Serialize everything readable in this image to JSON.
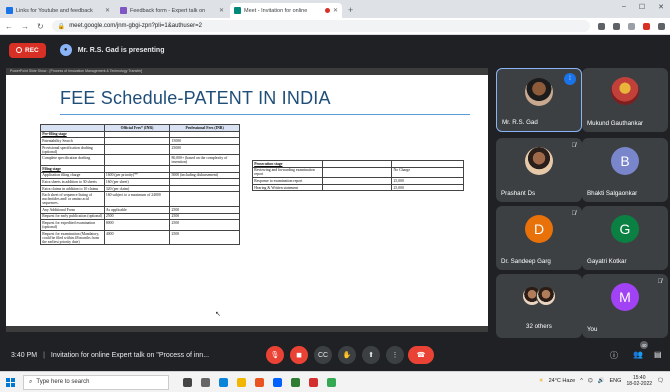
{
  "browser": {
    "tabs": [
      {
        "title": "Links for Youtube and feedback",
        "active": false,
        "color": "#1a73e8"
      },
      {
        "title": "Feedback form - Expert talk on",
        "active": false,
        "color": "#7e57c2"
      },
      {
        "title": "Meet - Invitation for online",
        "active": true,
        "color": "#00897b"
      }
    ],
    "url": "meet.google.com/jnm-gbgi-zpn?pli=1&authuser=2"
  },
  "meet": {
    "rec_label": "REC",
    "presenting_text": "Mr. R.S. Gad is presenting",
    "bottom_time": "3:40 PM",
    "meeting_title": "Invitation for online Expert talk on \"Process of inn...",
    "badge_count": "40"
  },
  "slide": {
    "window_title": "PowerPoint Slide Show - [Process of Innovation Management & Technology Transfer]",
    "title": "FEE Schedule-PATENT IN INDIA",
    "table1": {
      "headers": [
        "",
        "Official Fees* (INR)",
        "Professional Fees (INR)"
      ],
      "rows": [
        {
          "section": true,
          "cells": [
            "Pre-filing stage",
            "",
            ""
          ]
        },
        {
          "section": false,
          "cells": [
            "Patentability Search",
            "",
            "15000"
          ]
        },
        {
          "section": false,
          "cells": [
            "Provisional specification drafting (optional)",
            "",
            "25000"
          ]
        },
        {
          "section": false,
          "cells": [
            "Complete specification drafting",
            "",
            "80,000+ (based on the complexity of invention)"
          ]
        },
        {
          "section": true,
          "cells": [
            "Filing stage",
            "",
            ""
          ]
        },
        {
          "section": false,
          "cells": [
            "Application filing charge",
            "1600 (per priority)**",
            "5000 (including disbursement)"
          ]
        },
        {
          "section": false,
          "cells": [
            "Extra sheets in addition to 30 sheets",
            "160 (per sheet)",
            ""
          ]
        },
        {
          "section": false,
          "cells": [
            "Extra claims in addition to 10 claims",
            "320 (per claim)",
            ""
          ]
        },
        {
          "section": false,
          "cells": [
            "Each sheet of sequence listing of nucleotides and/ or amino acid sequences.",
            "160 subject to a maximum of 24000",
            ""
          ]
        },
        {
          "section": false,
          "cells": [
            "Any Additional Form",
            "As applicable",
            "2500"
          ]
        },
        {
          "section": false,
          "cells": [
            "Request for early publication (optional)",
            "2500",
            "2500"
          ]
        },
        {
          "section": false,
          "cells": [
            "Request for expedited examination (optional)",
            "8000",
            "2500"
          ]
        },
        {
          "section": false,
          "cells": [
            "Request for examination (Mandatory, could be filed within 48 months from the earliest priority date)",
            "4000",
            "2500"
          ]
        }
      ]
    },
    "table2": {
      "rows": [
        {
          "section": true,
          "cells": [
            "Prosecution stage",
            "",
            ""
          ]
        },
        {
          "section": false,
          "cells": [
            "Reviewing and forwarding examination report",
            "",
            "No Charge"
          ]
        },
        {
          "section": false,
          "cells": [
            "Response to examination report",
            "",
            "25,000"
          ]
        },
        {
          "section": false,
          "cells": [
            "Hearing & Written statement",
            "",
            "25,000"
          ]
        }
      ]
    }
  },
  "participants": [
    {
      "name": "Mr. R.S. Gad",
      "letter": "",
      "kind": "photo",
      "color": "#3c4043",
      "selected": true
    },
    {
      "name": "Mukund Gauthankar",
      "letter": "",
      "kind": "photo3",
      "color": "#3c4043",
      "selected": false
    },
    {
      "name": "Prashant Ds",
      "letter": "",
      "kind": "photo2",
      "color": "#3c4043",
      "selected": false
    },
    {
      "name": "Bhakti Salgaonkar",
      "letter": "B",
      "kind": "letter",
      "color": "#7986cb",
      "selected": false
    },
    {
      "name": "Dr. Sandeep Garg",
      "letter": "D",
      "kind": "letter",
      "color": "#e8710a",
      "selected": false
    },
    {
      "name": "Gayatri Kotkar",
      "letter": "G",
      "kind": "letter",
      "color": "#0b8043",
      "selected": false
    },
    {
      "name": "32 others",
      "letter": "",
      "kind": "group",
      "color": "#3c4043",
      "selected": false
    },
    {
      "name": "You",
      "letter": "M",
      "kind": "letter",
      "color": "#a142f4",
      "selected": false
    }
  ],
  "taskbar": {
    "search_placeholder": "Type here to search",
    "weather": "24°C Haze",
    "lang": "ENG",
    "time": "15:40",
    "date": "18-02-2022"
  }
}
